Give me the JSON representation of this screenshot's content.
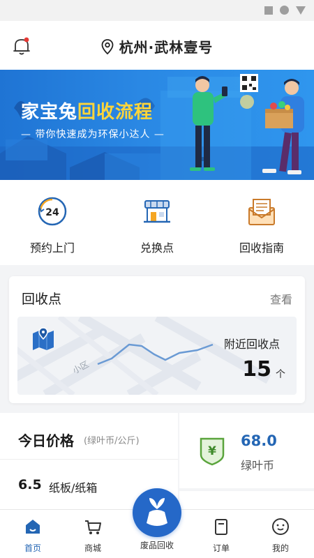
{
  "header": {
    "location": "杭州·武林壹号"
  },
  "banner": {
    "title_part1": "家宝兔",
    "title_part2": "回收流程",
    "subtitle": "— 带你快速成为环保小达人 —",
    "map_text": "小区"
  },
  "quick_actions": [
    {
      "label": "预约上门",
      "icon": "clock-24-icon"
    },
    {
      "label": "兑换点",
      "icon": "store-icon"
    },
    {
      "label": "回收指南",
      "icon": "envelope-guide-icon"
    }
  ],
  "recycle_points": {
    "title": "回收点",
    "view_label": "查看",
    "nearby_label": "附近回收点",
    "count": "15",
    "count_unit": "个",
    "map_area_label": "小区"
  },
  "prices": {
    "title": "今日价格",
    "unit": "(绿叶币/公斤)",
    "items": [
      {
        "value": "6.5",
        "name": "纸板/纸箱"
      }
    ]
  },
  "coins": {
    "value": "68.0",
    "label": "绿叶币"
  },
  "tabbar": {
    "items": [
      {
        "label": "首页",
        "active": true
      },
      {
        "label": "商城",
        "active": false
      },
      {
        "label": "废品回收",
        "active": false
      },
      {
        "label": "订单",
        "active": false
      },
      {
        "label": "我的",
        "active": false
      }
    ]
  },
  "colors": {
    "accent": "#2466b4",
    "brand_blue": "#2568c8",
    "banner_yellow": "#ffd53a",
    "coin_green": "#5aa43c"
  }
}
